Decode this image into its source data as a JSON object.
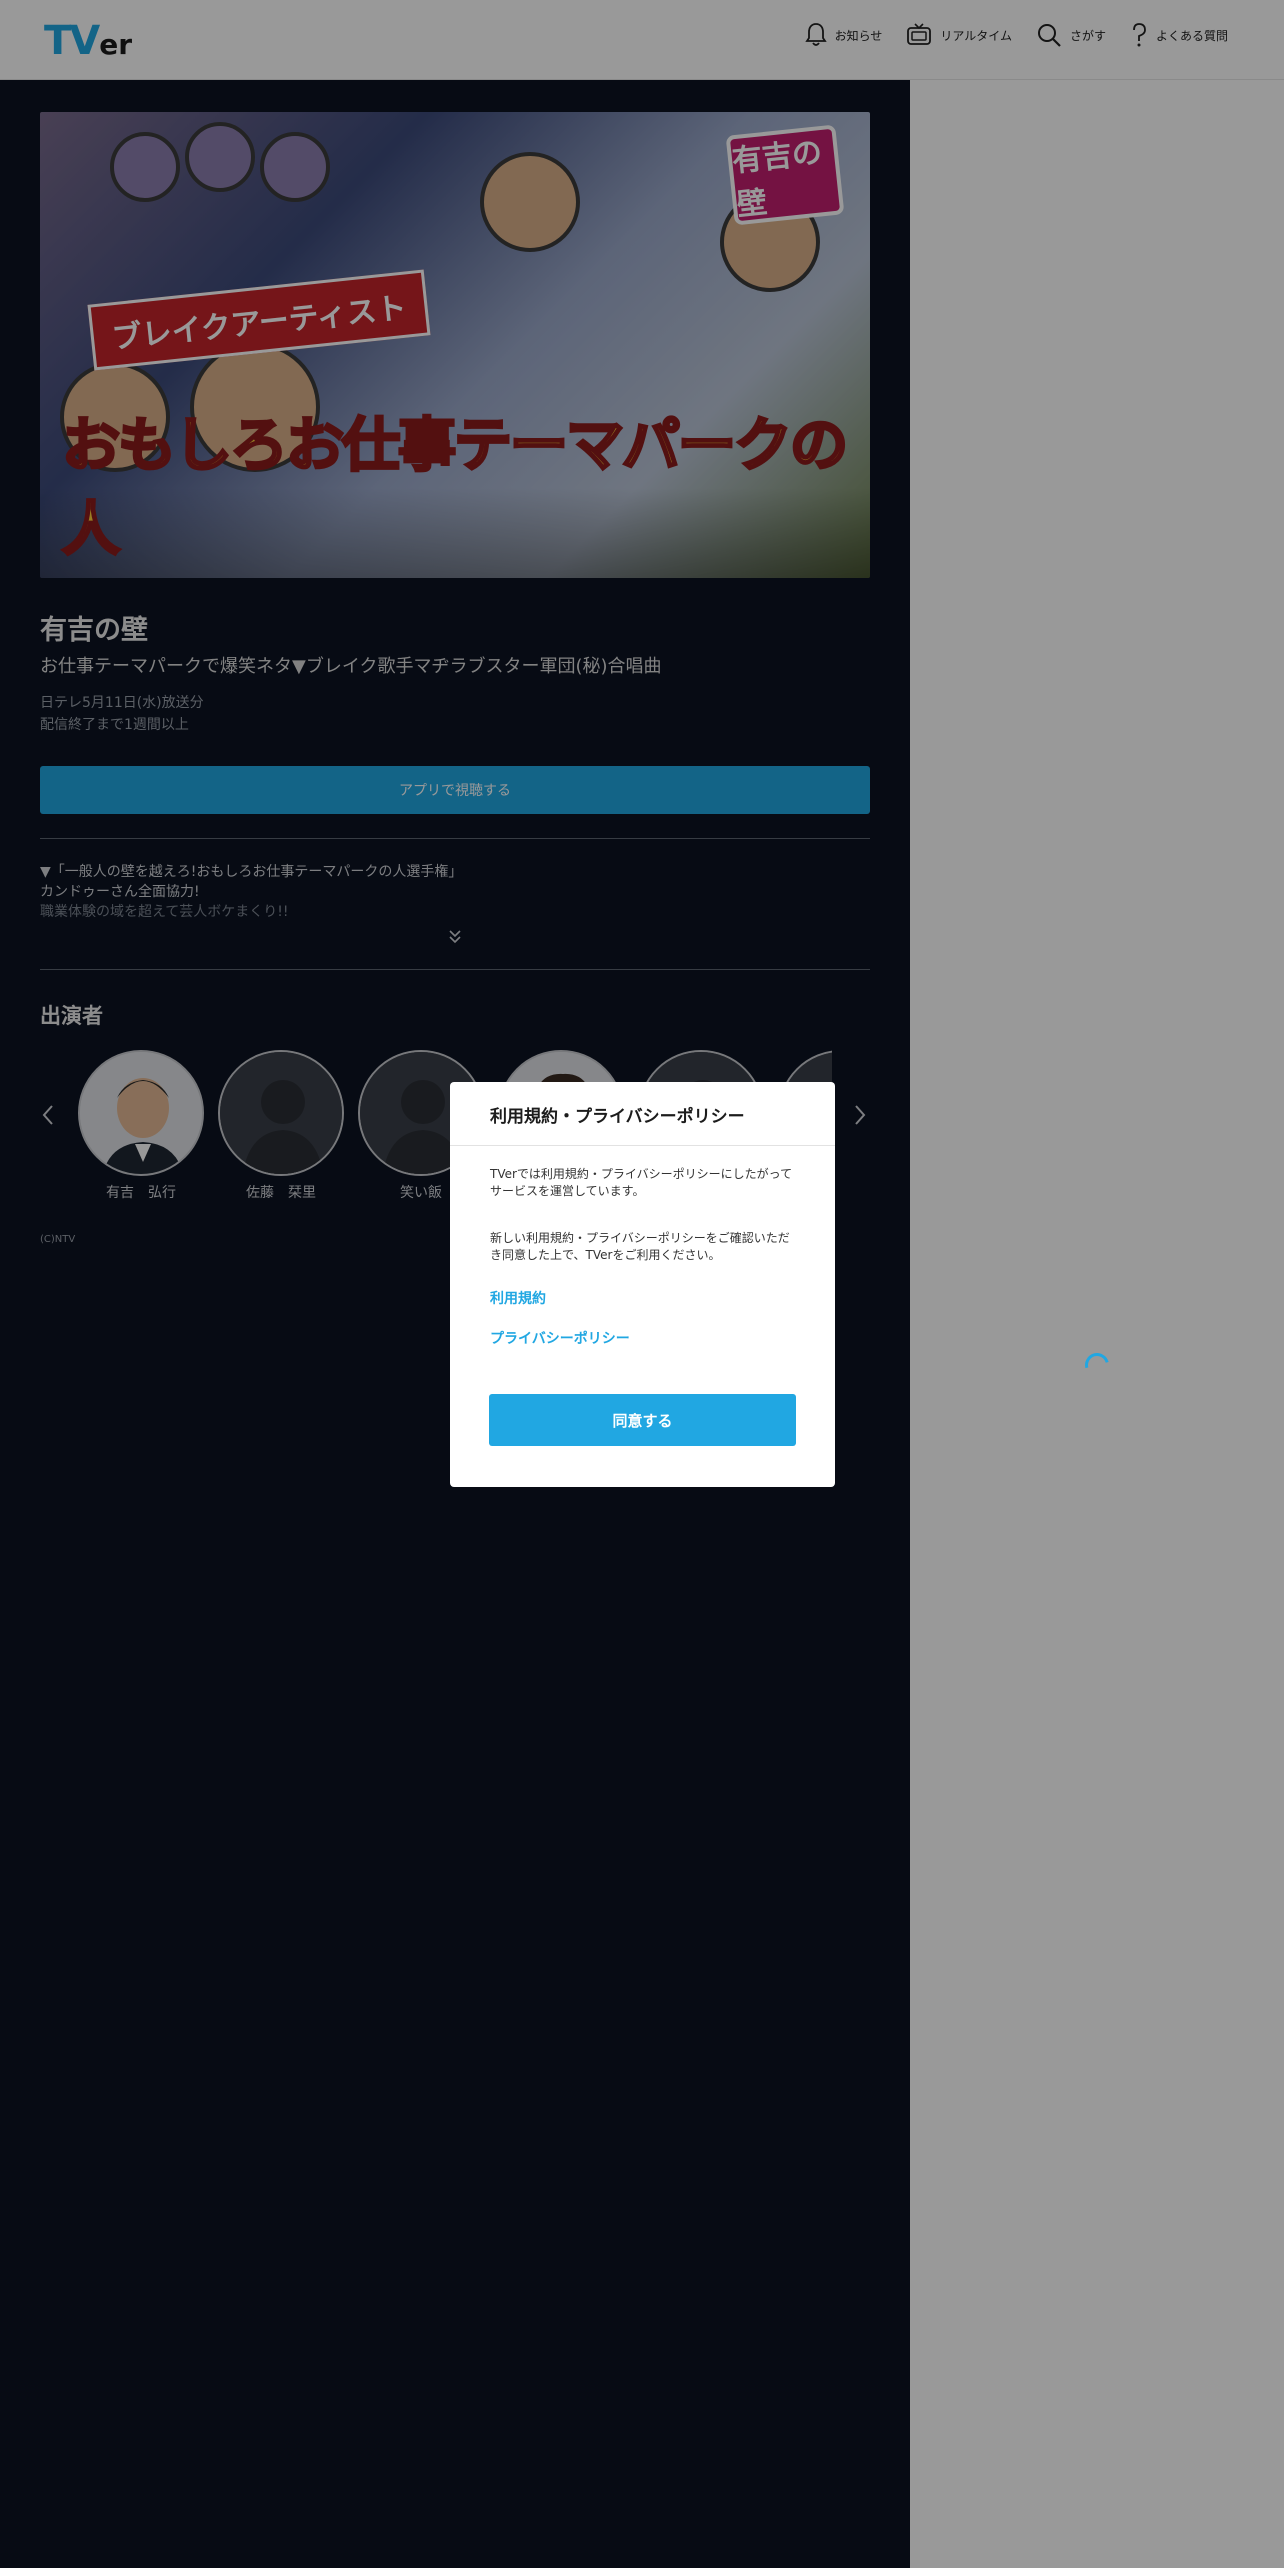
{
  "header": {
    "logo": {
      "tv": "TV",
      "er": "er"
    },
    "nav": [
      {
        "label": "お知らせ",
        "icon": "bell-icon"
      },
      {
        "label": "リアルタイム",
        "icon": "tv-icon"
      },
      {
        "label": "さがす",
        "icon": "search-icon"
      },
      {
        "label": "よくある質問",
        "icon": "question-icon"
      }
    ]
  },
  "episode": {
    "thumbnail_text": "おもしろお仕事テーマパークの人",
    "thumbnail_banner": "ブレイクアーティスト",
    "thumbnail_logo": "有吉の壁",
    "program_title": "有吉の壁",
    "episode_title": "お仕事テーマパークで爆笑ネタ▼ブレイク歌手マヂラブスター軍団(秘)合唱曲",
    "broadcast": "日テレ5月11日(水)放送分",
    "availability": "配信終了まで1週間以上",
    "app_button": "アプリで視聴する",
    "description_line1": "▼「一般人の壁を越えろ!おもしろお仕事テーマパークの人選手権」",
    "description_line2": "カンドゥーさん全面協力!",
    "description_line3": "職業体験の域を超えて芸人ボケまくり!!"
  },
  "cast": {
    "heading": "出演者",
    "members": [
      {
        "name": "有吉　弘行",
        "photo": true
      },
      {
        "name": "佐藤　栞里",
        "photo": false
      },
      {
        "name": "笑い飯",
        "photo": false
      },
      {
        "name": "",
        "photo": true
      },
      {
        "name": "",
        "photo": false
      },
      {
        "name": "",
        "photo": false
      }
    ]
  },
  "copyright": "(C)NTV",
  "modal": {
    "title": "利用規約・プライバシーポリシー",
    "paragraph1": "TVerでは利用規約・プライバシーポリシーにしたがってサービスを運営しています。",
    "paragraph2": "新しい利用規約・プライバシーポリシーをご確認いただき同意した上で、TVerをご利用ください。",
    "link_terms": "利用規約",
    "link_privacy": "プライバシーポリシー",
    "agree_button": "同意する"
  },
  "colors": {
    "accent": "#21a7e2",
    "main_bg": "#0c1322"
  }
}
